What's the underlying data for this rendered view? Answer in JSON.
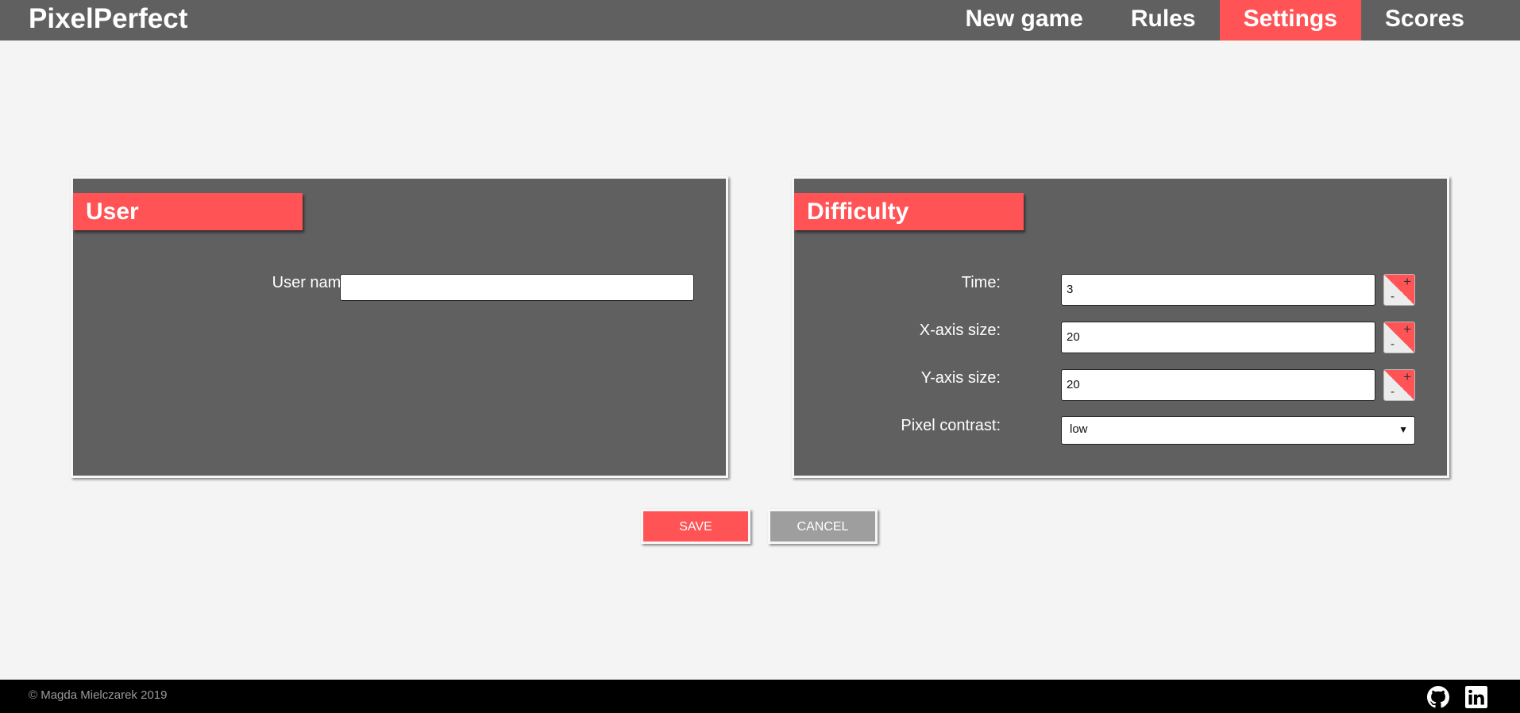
{
  "header": {
    "brand": "PixelPerfect",
    "nav": [
      {
        "label": "New game",
        "active": false
      },
      {
        "label": "Rules",
        "active": false
      },
      {
        "label": "Settings",
        "active": true
      },
      {
        "label": "Scores",
        "active": false
      }
    ]
  },
  "user_panel": {
    "title": "User",
    "username_label": "User name:",
    "username_value": ""
  },
  "difficulty_panel": {
    "title": "Difficulty",
    "time_label": "Time:",
    "time_value": "3",
    "x_label": "X-axis size:",
    "x_value": "20",
    "y_label": "Y-axis size:",
    "y_value": "20",
    "contrast_label": "Pixel contrast:",
    "contrast_value": "low",
    "stepper_plus": "+",
    "stepper_minus": "-"
  },
  "actions": {
    "save_label": "SAVE",
    "cancel_label": "CANCEL"
  },
  "footer": {
    "copyright": "© Magda Mielczarek 2019",
    "icons": [
      "github-icon",
      "linkedin-icon"
    ]
  },
  "colors": {
    "accent": "#ff5356",
    "panel": "#606060",
    "background": "#f4f4f4",
    "cancel": "#9e9e9e",
    "footer": "#000000"
  }
}
